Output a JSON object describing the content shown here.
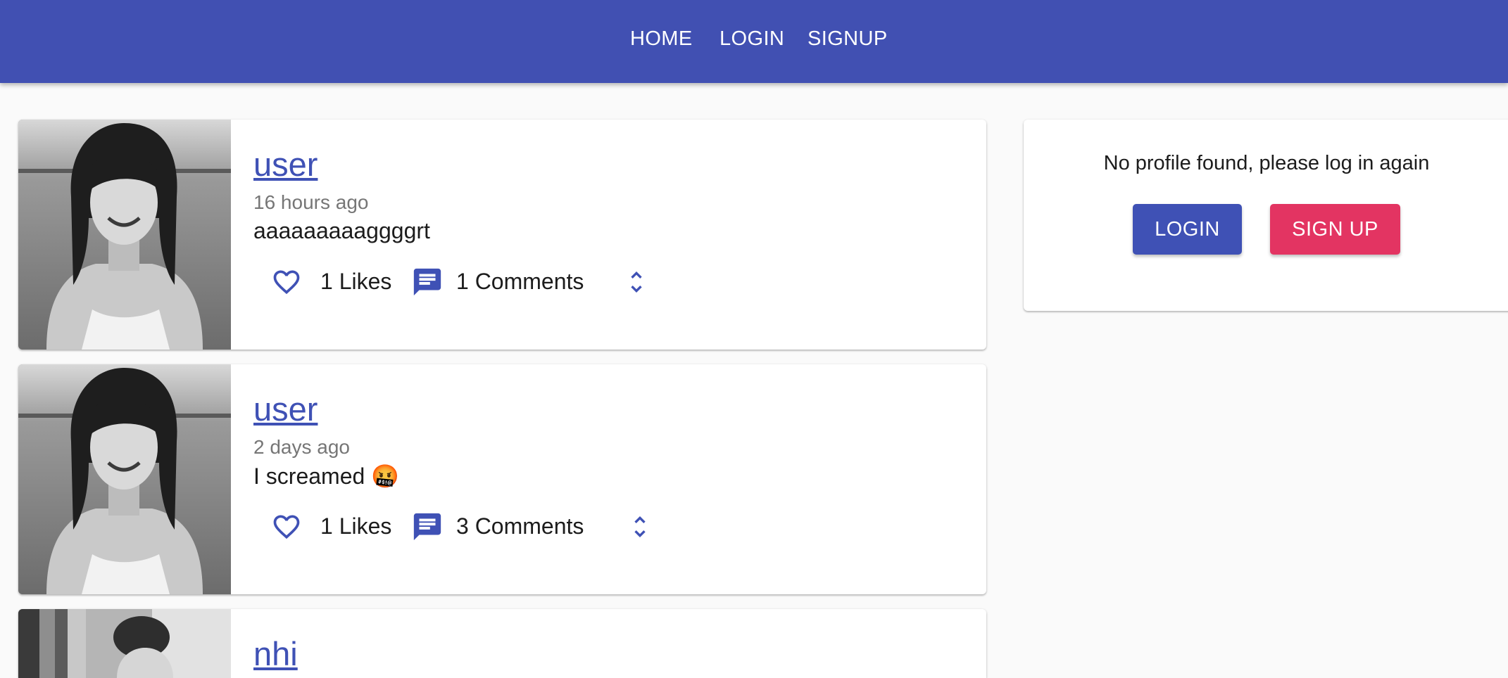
{
  "nav": {
    "home": "HOME",
    "login": "LOGIN",
    "signup": "SIGNUP"
  },
  "posts": [
    {
      "user": "user",
      "time": "16 hours ago",
      "body": "aaaaaaaaaggggrt",
      "likes": "1 Likes",
      "comments": "1 Comments"
    },
    {
      "user": "user",
      "time": "2 days ago",
      "body": "I screamed 🤬",
      "likes": "1 Likes",
      "comments": "3 Comments"
    },
    {
      "user": "nhi"
    }
  ],
  "profile": {
    "message": "No profile found, please log in again",
    "login_label": "LOGIN",
    "signup_label": "SIGN UP"
  },
  "icons": {
    "like": "heart-outline-icon",
    "comment": "chat-icon",
    "expand": "unfold-more-icon"
  },
  "colors": {
    "primary": "#3f51b5",
    "appbar": "#4150b2",
    "secondary": "#e33462"
  }
}
